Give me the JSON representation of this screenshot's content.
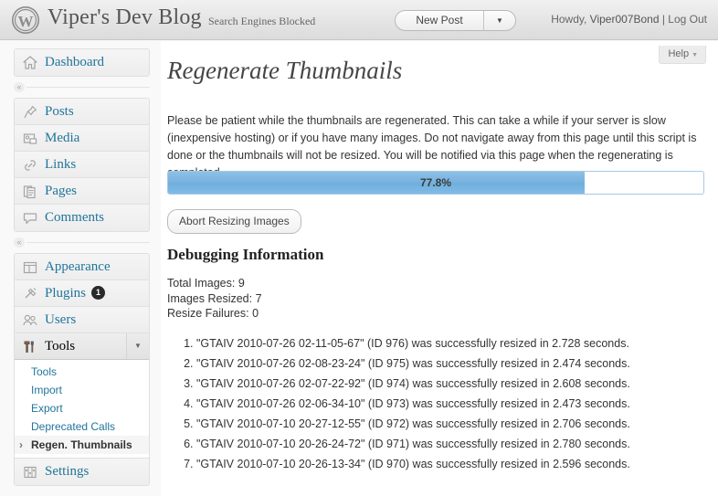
{
  "header": {
    "logo_icon": "wordpress-logo-icon",
    "site_title": "Viper's Dev Blog",
    "seo_note": "Search Engines Blocked",
    "new_post_label": "New Post",
    "new_post_caret_icon": "chevron-down-icon",
    "howdy_prefix": "Howdy, ",
    "username": "Viper007Bond",
    "separator": " | ",
    "logout_label": "Log Out"
  },
  "sidebar": {
    "groups": [
      {
        "items": [
          {
            "label": "Dashboard",
            "icon": "dashboard-home-icon",
            "current": false
          }
        ]
      },
      {
        "items": [
          {
            "label": "Posts",
            "icon": "pin-icon",
            "current": false
          },
          {
            "label": "Media",
            "icon": "media-icon",
            "current": false
          },
          {
            "label": "Links",
            "icon": "link-chain-icon",
            "current": false
          },
          {
            "label": "Pages",
            "icon": "pages-icon",
            "current": false
          },
          {
            "label": "Comments",
            "icon": "comment-bubble-icon",
            "current": false
          }
        ]
      },
      {
        "items": [
          {
            "label": "Appearance",
            "icon": "appearance-layout-icon",
            "current": false
          },
          {
            "label": "Plugins",
            "icon": "plugin-plug-icon",
            "current": false,
            "badge": "1"
          },
          {
            "label": "Users",
            "icon": "users-icon",
            "current": false
          },
          {
            "label": "Tools",
            "icon": "tools-hammer-icon",
            "current": true,
            "toggle_icon": "chevron-down-icon"
          },
          {
            "label": "Settings",
            "icon": "settings-gear-icon",
            "current": false
          }
        ]
      }
    ],
    "submenu": [
      {
        "label": "Tools",
        "active": false
      },
      {
        "label": "Import",
        "active": false
      },
      {
        "label": "Export",
        "active": false
      },
      {
        "label": "Deprecated Calls",
        "active": false
      },
      {
        "label": "Regen. Thumbnails",
        "active": true
      }
    ],
    "collapse_icon": "double-chevron-left-icon"
  },
  "main": {
    "help_label": "Help",
    "help_caret_icon": "chevron-down-icon",
    "page_title": "Regenerate Thumbnails",
    "intro": "Please be patient while the thumbnails are regenerated. This can take a while if your server is slow (inexpensive hosting) or if you have many images. Do not navigate away from this page until this script is done or the thumbnails will not be resized. You will be notified via this page when the regenerating is completed.",
    "progress": {
      "percent_label": "77.8%",
      "percent_value": 77.8,
      "fill_color": "#79b3de",
      "border_color": "#a6c9e2"
    },
    "abort_button_label": "Abort Resizing Images",
    "debug_title": "Debugging Information",
    "stats": [
      "Total Images: 9",
      "Images Resized: 7",
      "Resize Failures: 0"
    ],
    "results": [
      "\"GTAIV 2010-07-26 02-11-05-67\" (ID 976) was successfully resized in 2.728 seconds.",
      "\"GTAIV 2010-07-26 02-08-23-24\" (ID 975) was successfully resized in 2.474 seconds.",
      "\"GTAIV 2010-07-26 02-07-22-92\" (ID 974) was successfully resized in 2.608 seconds.",
      "\"GTAIV 2010-07-26 02-06-34-10\" (ID 973) was successfully resized in 2.473 seconds.",
      "\"GTAIV 2010-07-10 20-27-12-55\" (ID 972) was successfully resized in 2.706 seconds.",
      "\"GTAIV 2010-07-10 20-26-24-72\" (ID 971) was successfully resized in 2.780 seconds.",
      "\"GTAIV 2010-07-10 20-26-13-34\" (ID 970) was successfully resized in 2.596 seconds."
    ]
  }
}
